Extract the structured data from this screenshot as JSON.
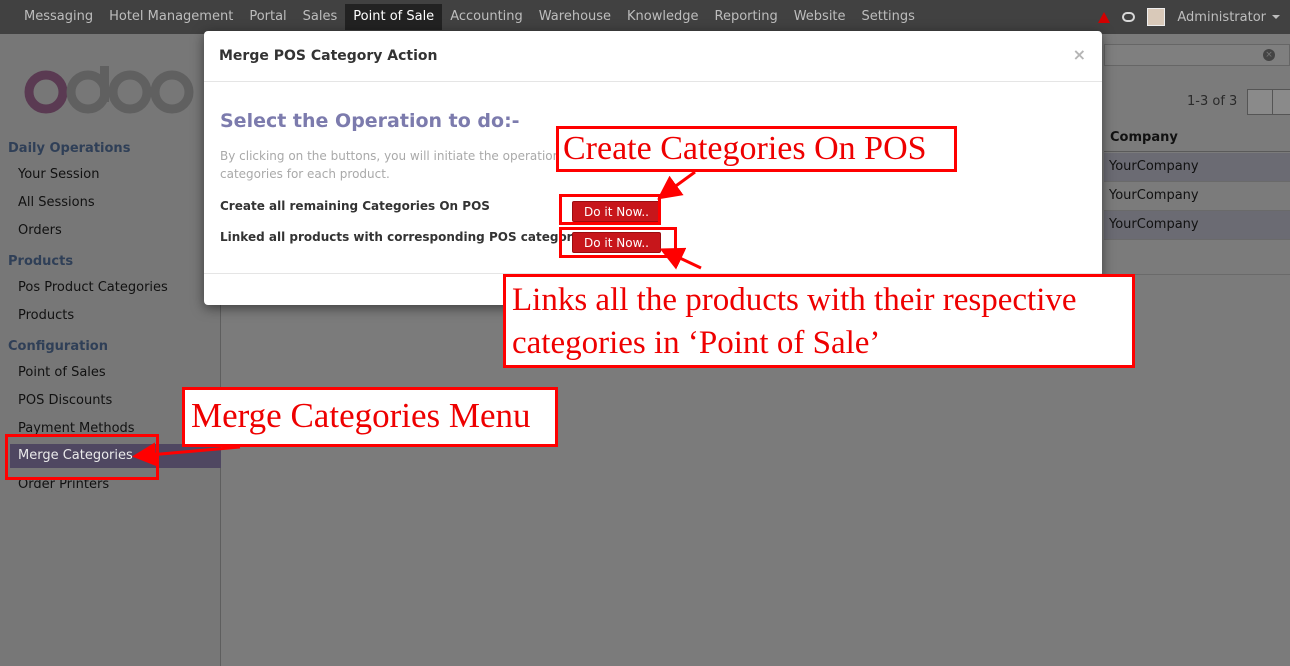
{
  "topbar": {
    "nav_items": [
      "Messaging",
      "Hotel Management",
      "Portal",
      "Sales",
      "Point of Sale",
      "Accounting",
      "Warehouse",
      "Knowledge",
      "Reporting",
      "Website",
      "Settings"
    ],
    "active_item": "Point of Sale",
    "user": "Administrator"
  },
  "sidebar": {
    "logo": "odoo",
    "sections": [
      {
        "title": "Daily Operations",
        "items": [
          "Your Session",
          "All Sessions",
          "Orders"
        ]
      },
      {
        "title": "Products",
        "items": [
          "Pos Product Categories",
          "Products"
        ]
      },
      {
        "title": "Configuration",
        "items": [
          "Point of Sales",
          "POS Discounts",
          "Payment Methods",
          "Merge Categories",
          "Order Printers"
        ]
      }
    ],
    "selected_item": "Merge Categories"
  },
  "list": {
    "pager": "1-3 of 3",
    "column_header": "Company",
    "rows": [
      "YourCompany",
      "YourCompany",
      "YourCompany"
    ]
  },
  "modal": {
    "title": "Merge POS Category Action",
    "close": "×",
    "heading": "Select the Operation to do:-",
    "description": "By clicking on the buttons, you will initiate the operations creation of categories on corresponding POS categories for each product.",
    "operations": [
      {
        "label": "Create all remaining Categories On POS",
        "button": "Do it Now.."
      },
      {
        "label": "Linked all products with corresponding POS category",
        "button": "Do it Now.."
      }
    ]
  },
  "annotations": {
    "create": "Create Categories On POS",
    "links_line1": "Links all the products with their respective",
    "links_line2": "categories in ‘Point of Sale’",
    "merge_menu": "Merge Categories Menu"
  },
  "colors": {
    "annotation": "#ff0000",
    "button": "#c7161b",
    "heading": "#7c7bad"
  }
}
